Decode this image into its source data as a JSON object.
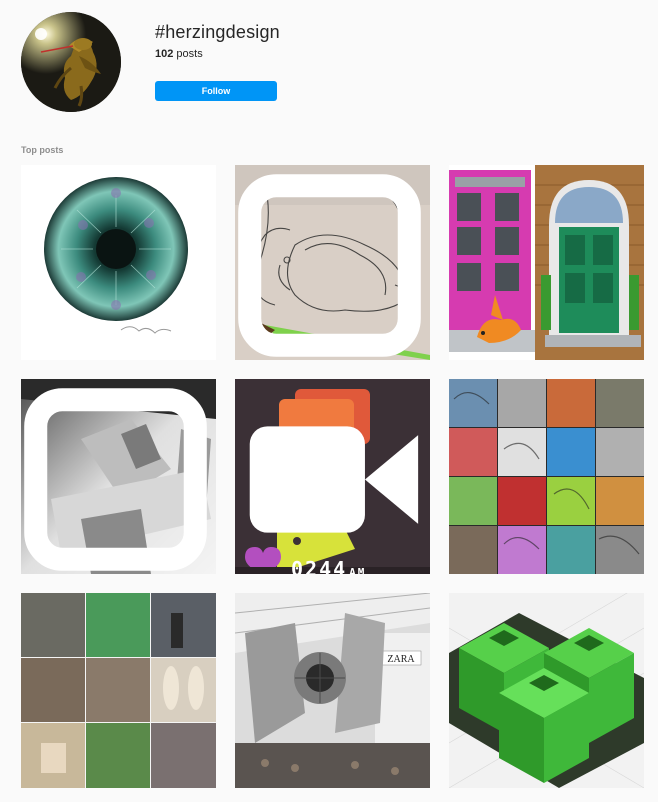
{
  "hashtag": {
    "title": "#herzingdesign",
    "post_count": "102",
    "post_count_label": "posts",
    "follow_label": "Follow"
  },
  "section": {
    "top_posts_label": "Top posts"
  },
  "colors": {
    "follow_button": "#0095f6",
    "background": "#fafafa",
    "muted_text": "#8e8e8e"
  },
  "posts": [
    {
      "id": "eye-illustration",
      "media": "image"
    },
    {
      "id": "sketch-squirrel",
      "media": "carousel"
    },
    {
      "id": "doors-fox",
      "media": "image"
    },
    {
      "id": "grayscale-city",
      "media": "carousel"
    },
    {
      "id": "chat-bubbles",
      "media": "video",
      "overlay_text": "0244",
      "overlay_sub": "AM"
    },
    {
      "id": "graffiti-collage",
      "media": "image"
    },
    {
      "id": "studio-collage",
      "media": "image"
    },
    {
      "id": "tie-fighter-mall",
      "media": "image",
      "store_sign": "ZARA"
    },
    {
      "id": "green-cubes",
      "media": "image"
    }
  ]
}
